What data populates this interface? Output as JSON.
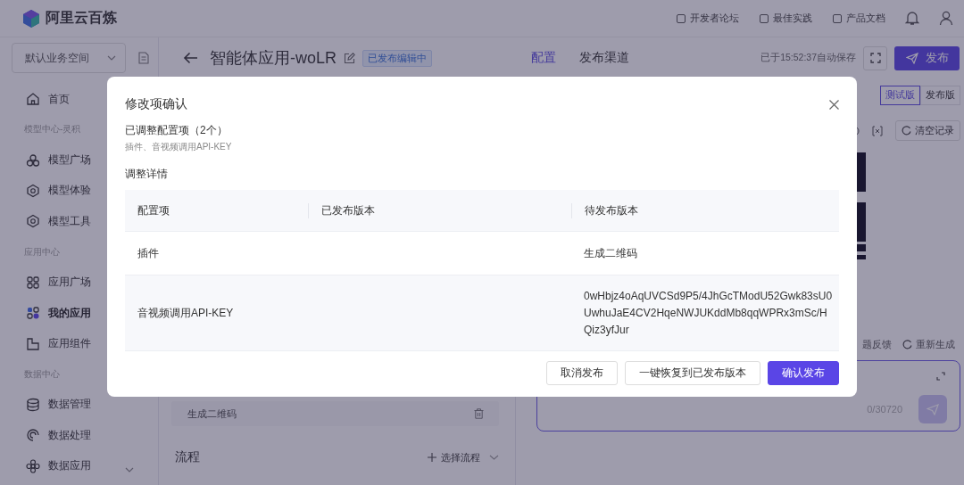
{
  "brand": {
    "name": "阿里云百炼"
  },
  "top_links": [
    {
      "label": "开发者论坛"
    },
    {
      "label": "最佳实践"
    },
    {
      "label": "产品文档"
    }
  ],
  "workspace": {
    "value": "默认业务空间"
  },
  "sidebar": {
    "items": [
      {
        "kind": "item",
        "label": "首页",
        "selected": false
      },
      {
        "kind": "heading",
        "label": "模型中心-灵积"
      },
      {
        "kind": "item",
        "label": "模型广场",
        "selected": false
      },
      {
        "kind": "item",
        "label": "模型体验",
        "selected": false
      },
      {
        "kind": "item",
        "label": "模型工具",
        "selected": false
      },
      {
        "kind": "heading",
        "label": "应用中心"
      },
      {
        "kind": "item",
        "label": "应用广场",
        "selected": false
      },
      {
        "kind": "item",
        "label": "我的应用",
        "selected": true
      },
      {
        "kind": "item",
        "label": "应用组件",
        "selected": false
      },
      {
        "kind": "heading",
        "label": "数据中心"
      },
      {
        "kind": "item",
        "label": "数据管理",
        "selected": false
      },
      {
        "kind": "item",
        "label": "数据处理",
        "selected": false
      },
      {
        "kind": "item",
        "label": "数据应用",
        "selected": false
      }
    ]
  },
  "header": {
    "title": "智能体应用-woLR",
    "status": "已发布编辑中",
    "tabs": [
      {
        "label": "配置",
        "selected": true
      },
      {
        "label": "发布渠道",
        "selected": false
      }
    ],
    "autosave": "已于15:52:37自动保存",
    "publish_button": "发布"
  },
  "preview": {
    "version_tabs": [
      {
        "label": "测试版",
        "selected": true
      },
      {
        "label": "发布版",
        "selected": false
      }
    ],
    "clear_button": "清空记录",
    "feedback": "题反馈",
    "regenerate": "重新生成",
    "counter": "0/30720"
  },
  "config": {
    "plugins": [
      {
        "name": "生成二维码"
      }
    ],
    "flow": {
      "title": "流程",
      "add_button": "选择流程"
    }
  },
  "dialog": {
    "title": "修改项确认",
    "summary_title": "已调整配置项（2个）",
    "summary_items": "插件、音视频调用API-KEY",
    "details_title": "调整详情",
    "table": {
      "columns": [
        "配置项",
        "已发布版本",
        "待发布版本"
      ],
      "rows": [
        {
          "item": "插件",
          "pending": "生成二维码"
        },
        {
          "item": "音视频调用API-KEY",
          "pending": "0wHbjz4oAqUVCSd9P5/4JhGcTModU52Gwk83sU0UwhuJaE4CV2HqeNWJUKddMb8qqWPRx3mSc/HQiz3yfJur"
        }
      ]
    },
    "buttons": [
      {
        "label": "取消发布",
        "kind": "default"
      },
      {
        "label": "一键恢复到已发布版本",
        "kind": "default"
      },
      {
        "label": "确认发布",
        "kind": "primary"
      }
    ]
  }
}
